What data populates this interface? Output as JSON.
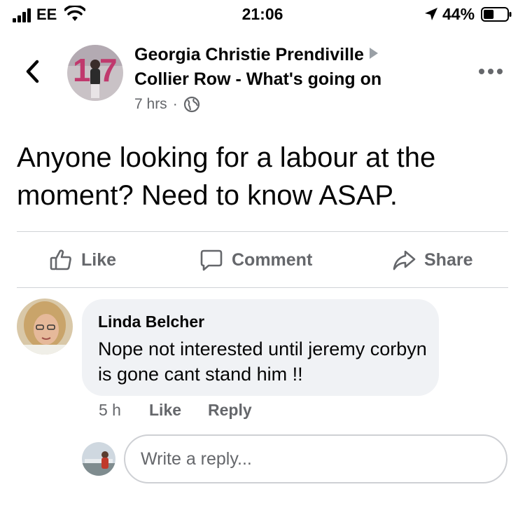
{
  "status_bar": {
    "carrier": "EE",
    "time": "21:06",
    "battery_percent": "44%",
    "battery_level": 0.44,
    "icons": [
      "signal-icon",
      "wifi-icon",
      "location-arrow-icon",
      "battery-icon"
    ]
  },
  "post": {
    "author": "Georgia Christie Prendiville",
    "group": "Collier Row - What's going on",
    "time": "7 hrs",
    "separator": "·",
    "audience_icon": "globe-icon",
    "text": "Anyone looking for a labour at the moment? Need to know ASAP."
  },
  "actions": {
    "like": "Like",
    "comment": "Comment",
    "share": "Share"
  },
  "comment": {
    "author": "Linda Belcher",
    "text": "Nope not interested until jeremy corbyn is gone cant stand him !!",
    "time": "5 h",
    "like_label": "Like",
    "reply_label": "Reply"
  },
  "reply_box": {
    "placeholder": "Write a reply..."
  },
  "colors": {
    "text_primary": "#050505",
    "text_secondary": "#65676b",
    "bubble_bg": "#f0f2f5",
    "divider": "#d0d3d7"
  }
}
